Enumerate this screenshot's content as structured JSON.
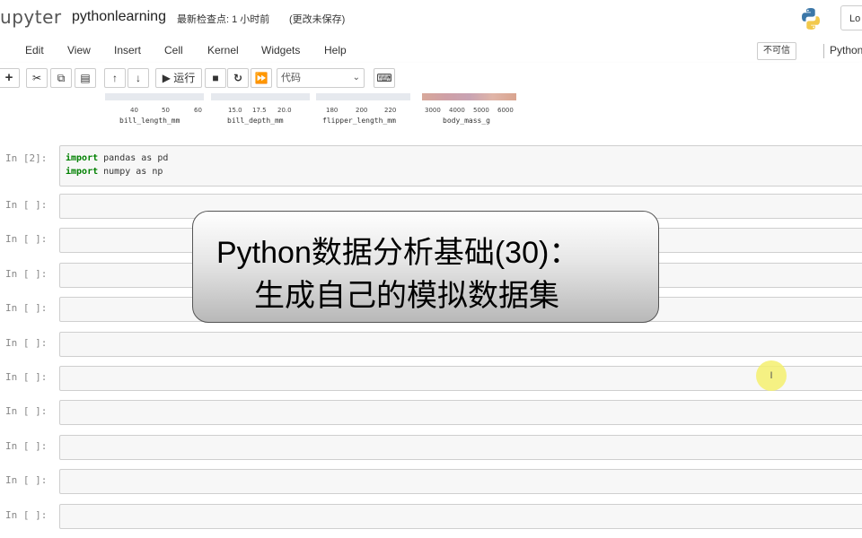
{
  "header": {
    "logo": "jupyter",
    "notebook_name": "pythonlearning",
    "checkpoint": "最新检查点: 1 小时前",
    "unsaved": "(更改未保存)",
    "logout": "Lo"
  },
  "menu": [
    "Edit",
    "View",
    "Insert",
    "Cell",
    "Kernel",
    "Widgets",
    "Help"
  ],
  "trusted_badge": "不可信",
  "kernel_name": "Python",
  "toolbar": {
    "run_label": "运行",
    "cell_type": "代码"
  },
  "plot_axes": {
    "labels": [
      "bill_length_mm",
      "bill_depth_mm",
      "flipper_length_mm",
      "body_mass_g"
    ],
    "ticks": [
      [
        "40",
        "50",
        "60"
      ],
      [
        "15.0",
        "17.5",
        "20.0"
      ],
      [
        "180",
        "200",
        "220"
      ],
      [
        "3000",
        "4000",
        "5000",
        "6000"
      ]
    ]
  },
  "cells": {
    "executed_prompt": "In [2]:",
    "code_lines": [
      {
        "kw": "import",
        "rest": " pandas as pd"
      },
      {
        "kw": "import",
        "rest": " numpy as np"
      }
    ],
    "empty_prompt": "In [ ]:",
    "empty_count": 10
  },
  "overlay": {
    "line1": "Python数据分析基础(30)：",
    "line2": "生成自己的模拟数据集"
  },
  "cursor_marker": "I"
}
